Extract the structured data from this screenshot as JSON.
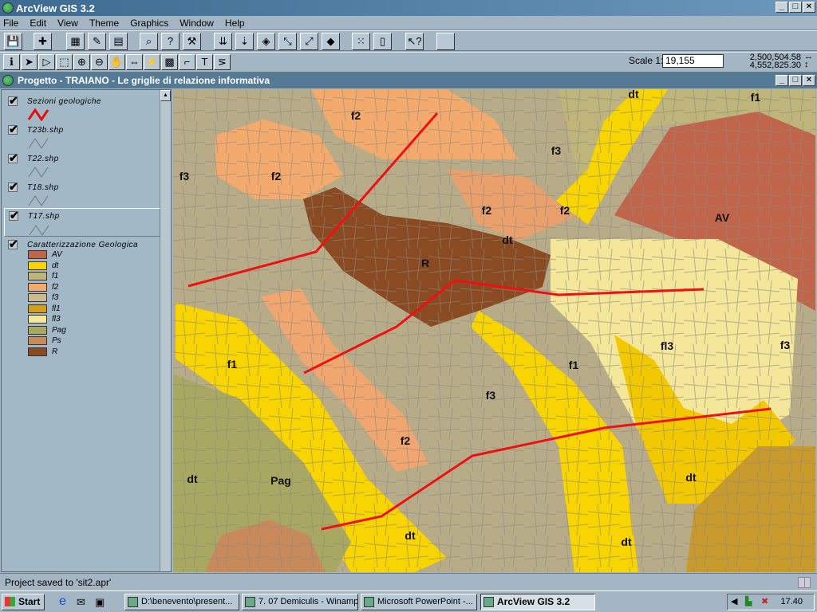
{
  "app": {
    "title": "ArcView GIS 3.2"
  },
  "menu": [
    "File",
    "Edit",
    "View",
    "Theme",
    "Graphics",
    "Window",
    "Help"
  ],
  "toolbar1": [
    {
      "icon": "save-icon",
      "g": "💾"
    },
    {
      "icon": "add-theme-icon",
      "g": "✚"
    },
    {
      "icon": "theme-properties-icon",
      "g": "▦"
    },
    {
      "icon": "edit-legend-icon",
      "g": "✎"
    },
    {
      "icon": "open-table-icon",
      "g": "▤"
    },
    {
      "icon": "find-icon",
      "g": "⌕"
    },
    {
      "icon": "locate-address-icon",
      "g": "?"
    },
    {
      "icon": "query-builder-icon",
      "g": "⚒"
    },
    {
      "icon": "zoom-full-extent-icon",
      "g": "⇊"
    },
    {
      "icon": "zoom-active-themes-icon",
      "g": "⇣"
    },
    {
      "icon": "zoom-selected-icon",
      "g": "◈"
    },
    {
      "icon": "zoom-in-fixed-icon",
      "g": "⤡"
    },
    {
      "icon": "zoom-out-fixed-icon",
      "g": "⤢"
    },
    {
      "icon": "zoom-previous-icon",
      "g": "◆"
    },
    {
      "icon": "select-none-icon",
      "g": "⁙"
    },
    {
      "icon": "layout-icon",
      "g": "▯"
    },
    {
      "icon": "help-icon",
      "g": "↖?"
    },
    {
      "icon": "blank-button-icon",
      "g": ""
    }
  ],
  "toolbar2": [
    {
      "icon": "identify-icon",
      "g": "ℹ"
    },
    {
      "icon": "pointer-icon",
      "g": "➤"
    },
    {
      "icon": "vertex-edit-icon",
      "g": "▷"
    },
    {
      "icon": "select-feature-icon",
      "g": "⬚"
    },
    {
      "icon": "zoom-in-icon",
      "g": "⊕"
    },
    {
      "icon": "zoom-out-icon",
      "g": "⊖"
    },
    {
      "icon": "pan-icon",
      "g": "✋"
    },
    {
      "icon": "measure-icon",
      "g": "⇔"
    },
    {
      "icon": "hotlink-icon",
      "g": "⚡"
    },
    {
      "icon": "area-select-icon",
      "g": "▩"
    },
    {
      "icon": "label-icon",
      "g": "⌐"
    },
    {
      "icon": "text-icon",
      "g": "T"
    },
    {
      "icon": "draw-icon",
      "g": "⋝"
    }
  ],
  "scale": {
    "label": "Scale 1:",
    "value": "19,155",
    "x": "2,500,504.58",
    "y": "4,552,825.30"
  },
  "document": {
    "title": "Progetto - TRAIANO - Le griglie di relazione informativa"
  },
  "toc": {
    "layers": [
      {
        "name": "Sezioni geologiche",
        "checked": true,
        "color": "#e41010"
      },
      {
        "name": "T23b.shp",
        "checked": true
      },
      {
        "name": "T22.shp",
        "checked": true
      },
      {
        "name": "T18.shp",
        "checked": true
      },
      {
        "name": "T17.shp",
        "checked": true,
        "active": true
      },
      {
        "name": "Caratterizzazione Geologica",
        "checked": true
      }
    ],
    "legend": [
      {
        "label": "AV",
        "color": "#c0654a"
      },
      {
        "label": "dt",
        "color": "#f8d400"
      },
      {
        "label": "f1",
        "color": "#bfb47a"
      },
      {
        "label": "f2",
        "color": "#f4aa6c"
      },
      {
        "label": "f3",
        "color": "#cdb98e"
      },
      {
        "label": "fl1",
        "color": "#d49e1c"
      },
      {
        "label": "fl3",
        "color": "#f4e79a"
      },
      {
        "label": "Pag",
        "color": "#a8a862"
      },
      {
        "label": "Ps",
        "color": "#c88a5a"
      },
      {
        "label": "R",
        "color": "#8a4a22"
      }
    ]
  },
  "map": {
    "labels": [
      "f2",
      "f3",
      "f1",
      "dt",
      "f3",
      "f2",
      "f2",
      "f2",
      "AV",
      "dt",
      "R",
      "fl3",
      "f3",
      "f1",
      "f1",
      "f3",
      "f2",
      "dt",
      "dt",
      "Pag",
      "dt",
      "dt"
    ],
    "section_color": "#ee1111"
  },
  "status": {
    "text": "Project saved to 'sit2.apr'"
  },
  "taskbar": {
    "start": "Start",
    "tasks": [
      "D:\\benevento\\present...",
      "7. 07 Demiculis - Winamp",
      "Microsoft PowerPoint -...",
      "ArcView GIS 3.2"
    ],
    "clock": "17.40"
  }
}
